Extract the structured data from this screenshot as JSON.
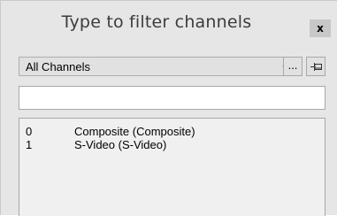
{
  "window": {
    "title": "Type to filter channels",
    "close_label": "x"
  },
  "toolbar": {
    "dropdown_selected": "All Channels",
    "ellipsis_label": "...",
    "pin_icon": "pin-icon",
    "chevron_icon": "chevron-down-icon"
  },
  "search": {
    "value": "",
    "placeholder": ""
  },
  "channels": [
    {
      "index": "0",
      "name": "Composite  (Composite)"
    },
    {
      "index": "1",
      "name": "S-Video  (S-Video)"
    }
  ],
  "colors": {
    "panel_bg": "#e6e6e6",
    "list_bg": "#f0f0f0",
    "close_bg": "#c8c8c8"
  }
}
